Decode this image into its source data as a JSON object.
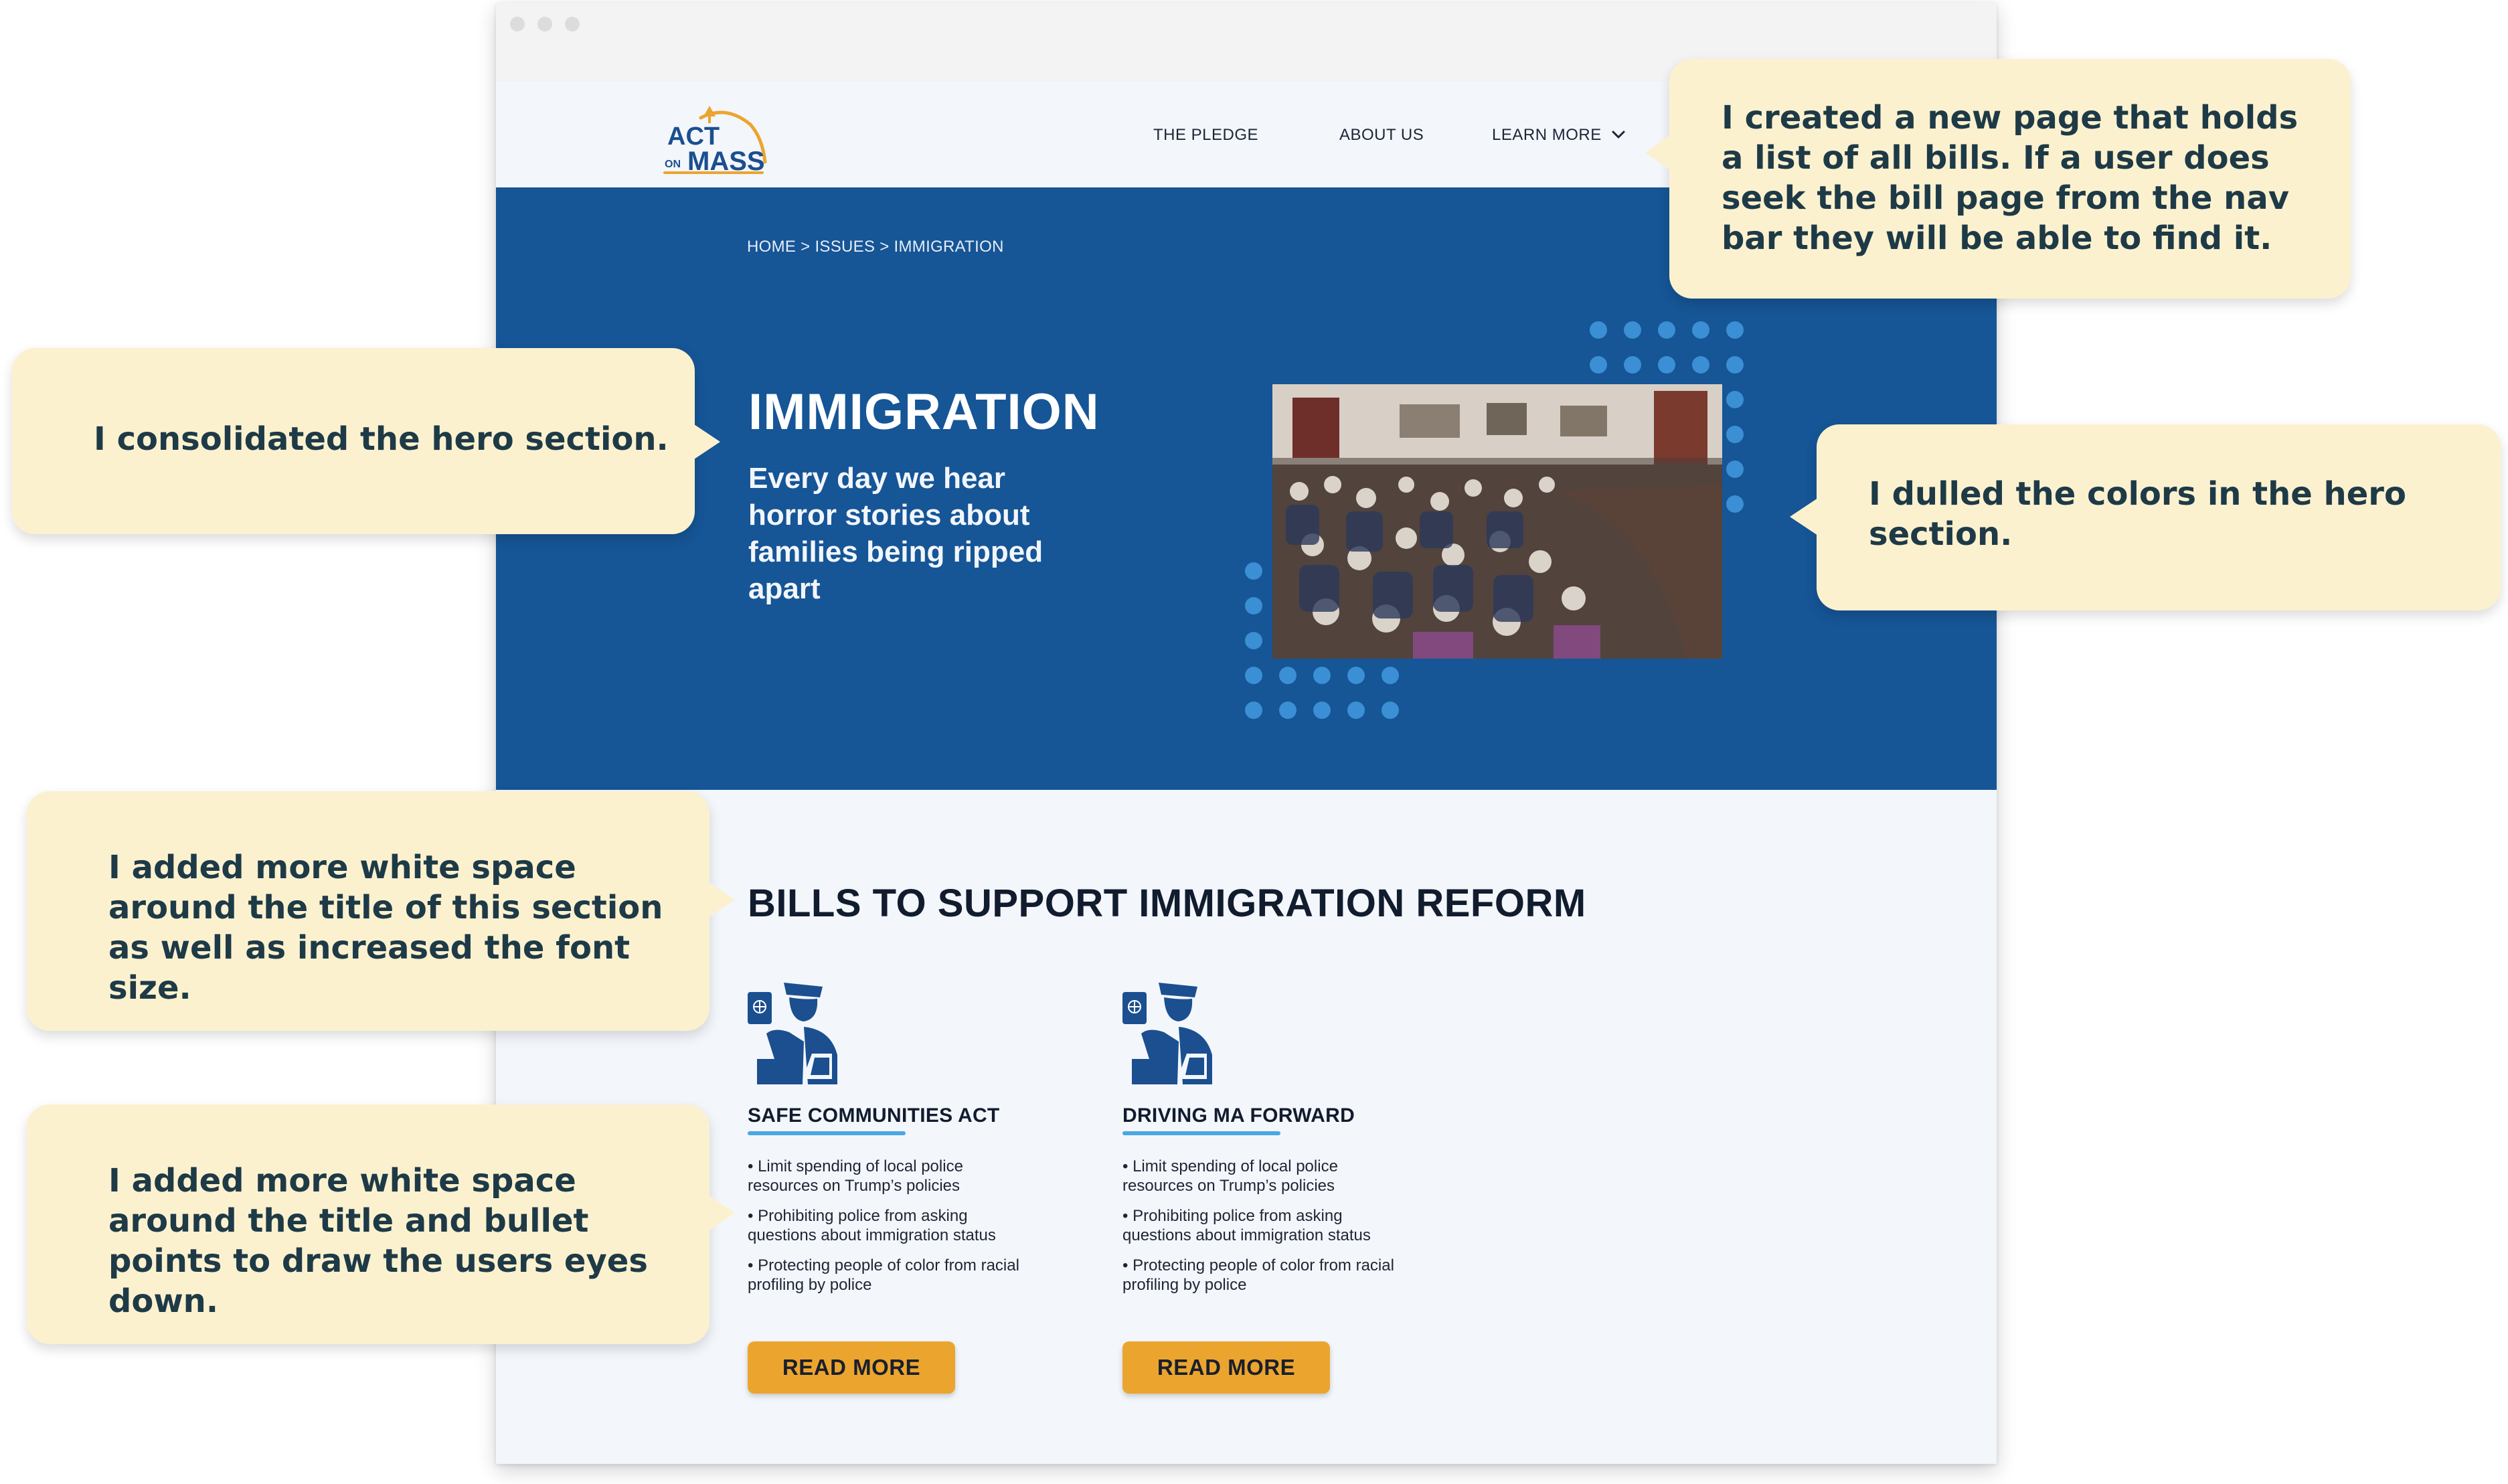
{
  "logo": {
    "line1": "ACT",
    "line2_prefix": "ON",
    "line2": "MASS"
  },
  "nav": {
    "items": [
      "THE PLEDGE",
      "ABOUT US",
      "LEARN MORE"
    ]
  },
  "breadcrumb": "HOME > ISSUES > IMMIGRATION",
  "hero": {
    "title": "IMMIGRATION",
    "subtitle": "Every day we hear horror stories about families being ripped apart"
  },
  "bills": {
    "title": "BILLS TO SUPPORT IMMIGRATION REFORM",
    "cards": [
      {
        "title": "SAFE COMMUNITIES ACT",
        "bullets": [
          "• Limit spending of local police resources on Trump’s policies",
          "• Prohibiting police from asking questions about immigration status",
          "• Protecting people of color from racial profiling by police"
        ],
        "button": "READ MORE"
      },
      {
        "title": "DRIVING MA FORWARD",
        "bullets": [
          "• Limit spending of local police resources on Trump’s policies",
          "• Prohibiting police from asking questions about immigration status",
          "• Protecting people of color from racial profiling by police"
        ],
        "button": "READ MORE"
      }
    ]
  },
  "callouts": {
    "new_page": "I created a new page that holds a list of all bills. If a user does seek the bill page from the nav bar they will be able to find it.",
    "hero_consolidated": "I consolidated the hero section.",
    "dulled_colors": "I dulled the colors in the hero section.",
    "title_whitespace": "I added more white space around the title of this section as well as increased the font size.",
    "bullet_whitespace": "I added more white space around the title and bullet points to draw the users eyes down."
  },
  "colors": {
    "hero_blue": "#165596",
    "accent_dot_blue": "#3b8fd4",
    "underline_blue": "#4ba7e3",
    "button_orange": "#eba52f",
    "callout_cream": "#fcf1cf",
    "logo_orange": "#eba52f",
    "logo_blue": "#1b4f8f"
  },
  "icons": [
    "chevron-down-icon",
    "customs-officer-passport-icon"
  ]
}
